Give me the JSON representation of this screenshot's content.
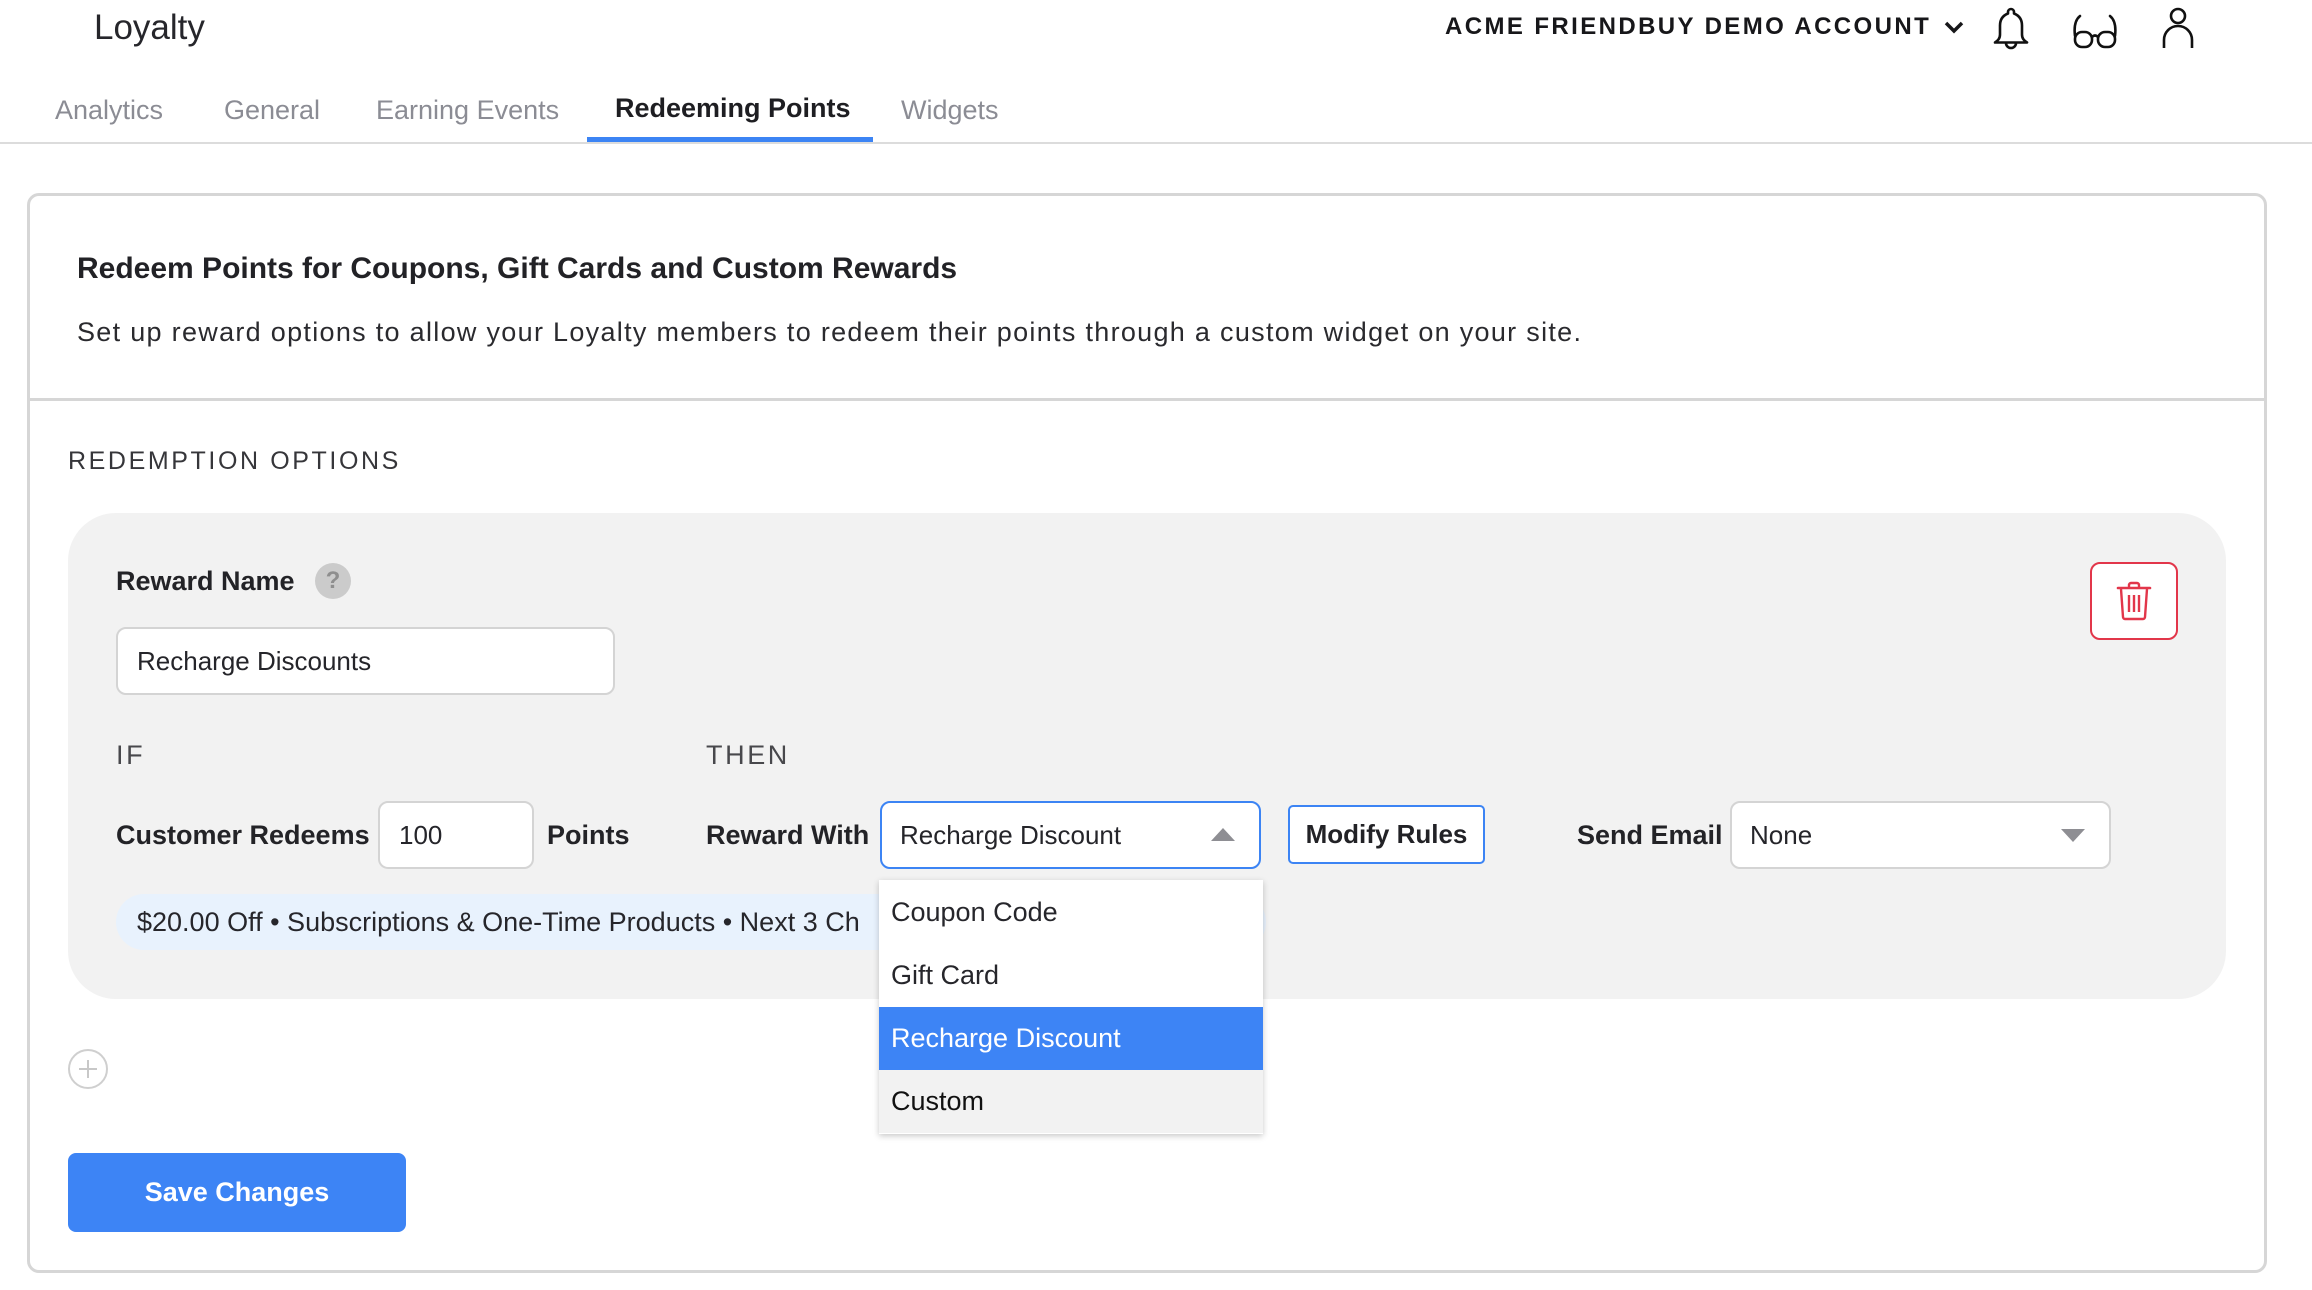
{
  "app": {
    "title": "Loyalty",
    "account_name": "ACME FRIENDBUY DEMO ACCOUNT",
    "icons": [
      "chevron-down-icon",
      "bell-icon",
      "glasses-icon",
      "user-icon"
    ]
  },
  "tabs": [
    {
      "label": "Analytics",
      "active": false
    },
    {
      "label": "General",
      "active": false
    },
    {
      "label": "Earning Events",
      "active": false
    },
    {
      "label": "Redeeming Points",
      "active": true
    },
    {
      "label": "Widgets",
      "active": false
    }
  ],
  "card": {
    "title": "Redeem Points for Coupons, Gift Cards and Custom Rewards",
    "description": "Set up reward options to allow your Loyalty members to redeem their points through a custom widget on your site."
  },
  "redemption": {
    "section_label": "REDEMPTION OPTIONS",
    "reward_name_label": "Reward Name",
    "help_icon": "?",
    "reward_name_value": "Recharge Discounts",
    "if_label": "IF",
    "then_label": "THEN",
    "customer_redeems_label": "Customer Redeems",
    "points_value": "100",
    "points_label": "Points",
    "reward_with_label": "Reward With",
    "reward_with_value": "Recharge Discount",
    "modify_rules_label": "Modify Rules",
    "send_email_label": "Send Email",
    "send_email_value": "None",
    "summary": "$20.00 Off • Subscriptions & One-Time Products • Next 3 Ch"
  },
  "reward_type_dropdown": {
    "open": true,
    "options": [
      {
        "label": "Coupon Code",
        "state": "normal"
      },
      {
        "label": "Gift Card",
        "state": "normal"
      },
      {
        "label": "Recharge Discount",
        "state": "selected"
      },
      {
        "label": "Custom",
        "state": "hover"
      }
    ]
  },
  "actions": {
    "save_label": "Save Changes"
  },
  "colors": {
    "accent": "#3c84f4",
    "danger": "#e2364a",
    "panel_bg": "#f2f2f2",
    "summary_bg": "#e8f2fd"
  }
}
